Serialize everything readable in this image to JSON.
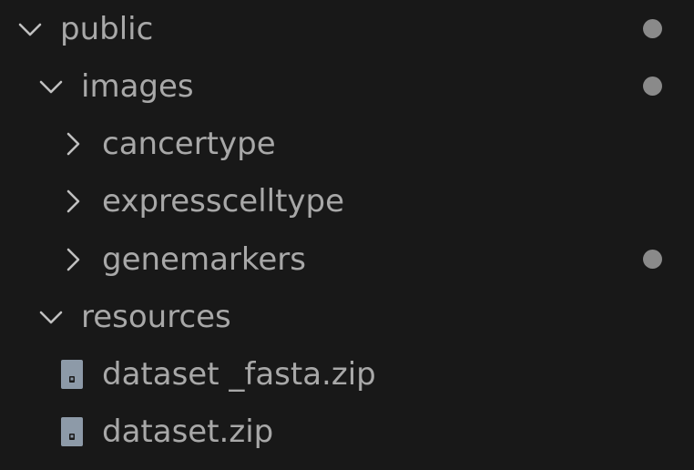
{
  "explorer": {
    "items": [
      {
        "label": "public",
        "type": "folder",
        "expanded": true,
        "icon": "chevron-down-icon",
        "modified": true
      },
      {
        "label": "images",
        "type": "folder",
        "expanded": true,
        "icon": "chevron-down-icon",
        "modified": true
      },
      {
        "label": "cancertype",
        "type": "folder",
        "expanded": false,
        "icon": "chevron-right-icon",
        "modified": false
      },
      {
        "label": "expresscelltype",
        "type": "folder",
        "expanded": false,
        "icon": "chevron-right-icon",
        "modified": false
      },
      {
        "label": "genemarkers",
        "type": "folder",
        "expanded": false,
        "icon": "chevron-right-icon",
        "modified": true
      },
      {
        "label": "resources",
        "type": "folder",
        "expanded": true,
        "icon": "chevron-down-icon",
        "modified": false
      },
      {
        "label": "dataset _fasta.zip",
        "type": "file",
        "icon": "zip-file-icon",
        "modified": false
      },
      {
        "label": "dataset.zip",
        "type": "file",
        "icon": "zip-file-icon",
        "modified": false
      }
    ]
  },
  "colors": {
    "background": "#181818",
    "text": "#a8a8a8",
    "chevron": "#c0c0c0",
    "modified_dot": "#8a8a8a",
    "zip_icon": "#8d9aa8"
  }
}
